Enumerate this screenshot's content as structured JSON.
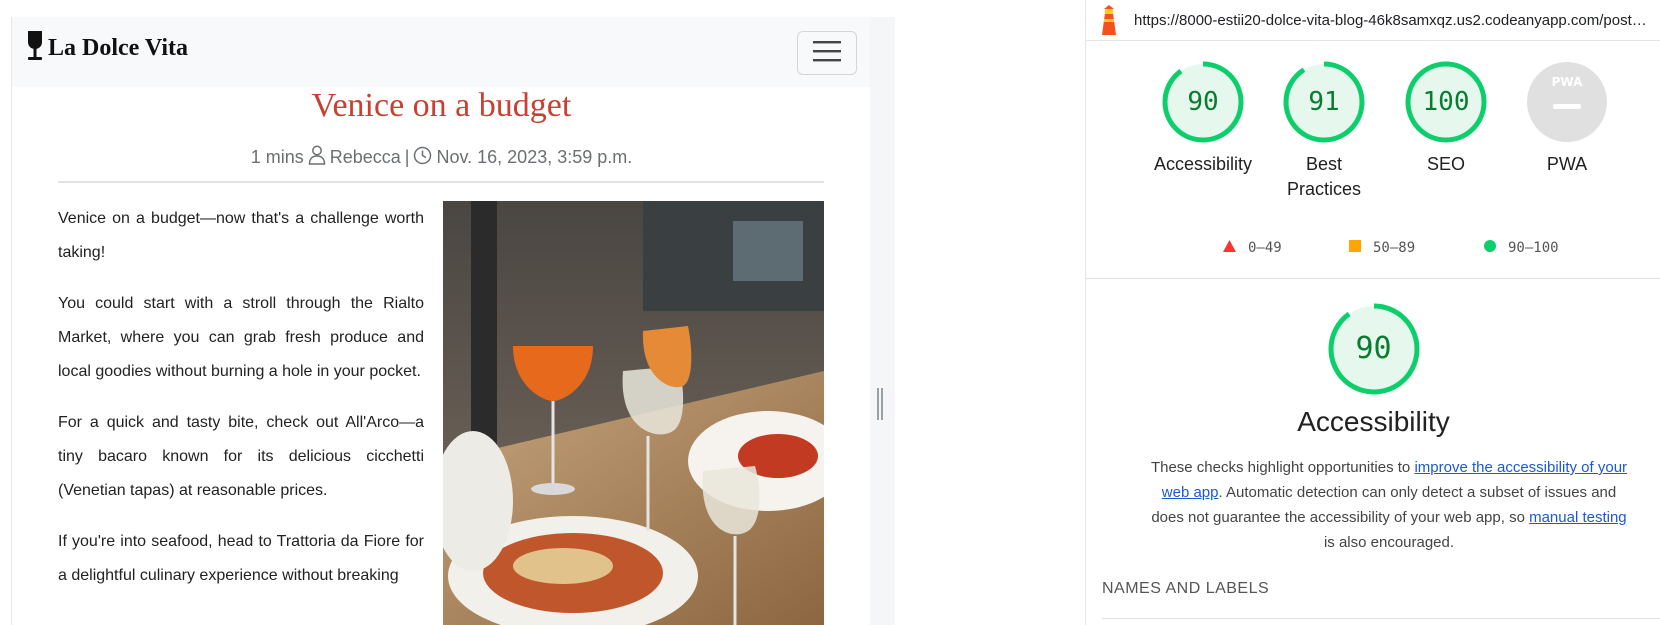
{
  "blog": {
    "brand": "La Dolce Vita",
    "title": "Venice on a budget",
    "meta": {
      "read_time": "1 mins",
      "author": "Rebecca",
      "separator": "|",
      "date": "Nov. 16, 2023, 3:59 p.m."
    },
    "paragraphs": [
      "Venice on a budget—now that's a challenge worth taking!",
      "You could start with a stroll through the Rialto Market, where you can grab fresh produce and local goodies without burning a hole in your pocket.",
      "For a quick and tasty bite, check out All'Arco—a tiny bacaro known for its delicious cicchetti (Venetian tapas) at reasonable prices.",
      "If you're into seafood, head to Trattoria da Fiore for a delightful culinary experience without breaking"
    ]
  },
  "lighthouse": {
    "url": "https://8000-estii20-dolce-vita-blog-46k8samxqz.us2.codeanyapp.com/post/v...",
    "scores": [
      {
        "label": "Accessibility",
        "value": "90",
        "pct": 90
      },
      {
        "label": "Best Practices",
        "value": "91",
        "pct": 91
      },
      {
        "label": "SEO",
        "value": "100",
        "pct": 100
      },
      {
        "label": "PWA",
        "value": "PWA",
        "pct": 0
      }
    ],
    "legend": [
      "0–49",
      "50–89",
      "90–100"
    ],
    "focus": {
      "score": "90",
      "pct": 90,
      "title": "Accessibility",
      "desc_1": "These checks highlight opportunities to ",
      "link_1": "improve the accessibility of your web app",
      "desc_2": ". Automatic detection can only detect a subset of issues and does not guarantee the accessibility of your web app, so ",
      "link_2": "manual testing",
      "desc_3": " is also encouraged."
    },
    "section_heading": "NAMES AND LABELS"
  },
  "colors": {
    "title_red": "#c94032",
    "pass_green": "#0cce6b",
    "score_text_green": "#0a7c2f",
    "fail_red": "#ff3333",
    "average_orange": "#ffa400",
    "link_blue": "#1a59d6"
  }
}
